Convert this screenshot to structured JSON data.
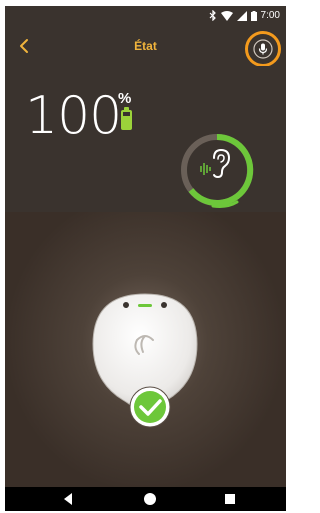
{
  "status_bar": {
    "time": "7:00",
    "icons": [
      "bluetooth-icon",
      "wifi-icon",
      "signal-icon",
      "battery-icon"
    ]
  },
  "header": {
    "title": "État",
    "back_icon": "chevron-left-icon",
    "mic_icon": "microphone-icon"
  },
  "battery": {
    "level_value": "100",
    "percent_sign": "%",
    "charge_fraction": 1.0
  },
  "hearing_status": {
    "icon": "ear-with-sound-icon"
  },
  "device": {
    "status": "check-mark-icon"
  },
  "colors": {
    "accent": "#f0b43c",
    "highlight": "#f39a1d",
    "green": "#6dc73a",
    "background": "#3a332e"
  },
  "nav_bar": {
    "buttons": [
      "back-triangle-icon",
      "home-circle-icon",
      "recent-square-icon"
    ]
  }
}
